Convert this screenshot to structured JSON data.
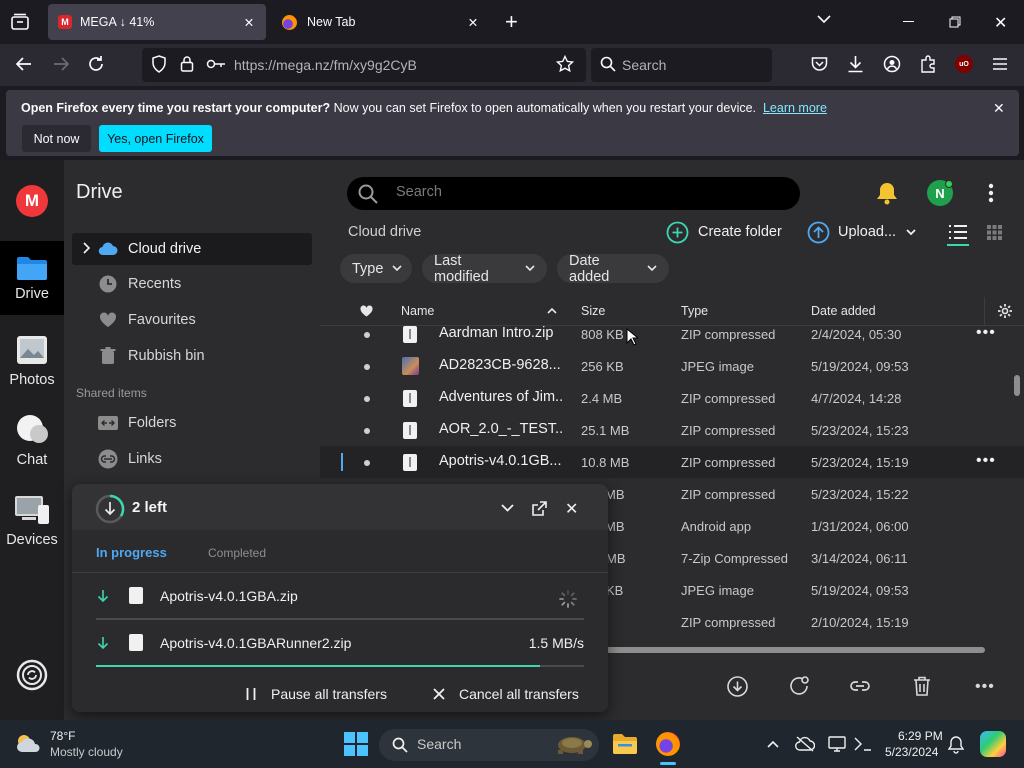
{
  "browser": {
    "tabs": [
      {
        "label": "MEGA ↓ 41%",
        "active": true
      },
      {
        "label": "New Tab",
        "active": false
      }
    ],
    "url": "https://mega.nz/fm/xy9g2CyB",
    "search_placeholder": "Search"
  },
  "notification": {
    "bold": "Open Firefox every time you restart your computer?",
    "text": " Now you can set Firefox to open automatically when you restart your device.",
    "link": "Learn more",
    "not_now": "Not now",
    "yes_button": "Yes, open Firefox"
  },
  "rail": {
    "drive": "Drive",
    "photos": "Photos",
    "chat": "Chat",
    "devices": "Devices"
  },
  "sidebar": {
    "title": "Drive",
    "items": [
      {
        "label": "Cloud drive"
      },
      {
        "label": "Recents"
      },
      {
        "label": "Favourites"
      },
      {
        "label": "Rubbish bin"
      }
    ],
    "shared_heading": "Shared items",
    "shared_items": [
      {
        "label": "Folders"
      },
      {
        "label": "Links"
      }
    ]
  },
  "main": {
    "search_placeholder": "Search",
    "avatar_letter": "N",
    "breadcrumb": "Cloud drive",
    "create_folder": "Create folder",
    "upload": "Upload...",
    "filters": {
      "type": "Type",
      "last_modified": "Last modified",
      "date_added": "Date added"
    },
    "columns": {
      "name": "Name",
      "size": "Size",
      "type": "Type",
      "date_added": "Date added"
    },
    "rows": [
      {
        "name": "Aardman Intro.zip",
        "size": "808 KB",
        "type": "ZIP compressed",
        "date": "2/4/2024, 05:30"
      },
      {
        "name": "AD2823CB-9628...",
        "size": "256 KB",
        "type": "JPEG image",
        "date": "5/19/2024, 09:53"
      },
      {
        "name": "Adventures of Jim...",
        "size": "2.4 MB",
        "type": "ZIP compressed",
        "date": "4/7/2024, 14:28"
      },
      {
        "name": "AOR_2.0_-_TEST....",
        "size": "25.1 MB",
        "type": "ZIP compressed",
        "date": "5/23/2024, 15:23"
      },
      {
        "name": "Apotris-v4.0.1GB...",
        "size": "10.8 MB",
        "type": "ZIP compressed",
        "date": "5/23/2024, 15:19"
      },
      {
        "name": "",
        "size": "MB",
        "type": "ZIP compressed",
        "date": "5/23/2024, 15:22"
      },
      {
        "name": "",
        "size": "MB",
        "type": "Android app",
        "date": "1/31/2024, 06:00"
      },
      {
        "name": "",
        "size": "MB",
        "type": "7-Zip Compressed",
        "date": "3/14/2024, 06:11"
      },
      {
        "name": "",
        "size": "KB",
        "type": "JPEG image",
        "date": "5/19/2024, 09:53"
      },
      {
        "name": "",
        "size": "",
        "type": "ZIP compressed",
        "date": "2/10/2024, 15:19"
      }
    ]
  },
  "transfers": {
    "title": "2 left",
    "tab_in_progress": "In progress",
    "tab_completed": "Completed",
    "items": [
      {
        "name": "Apotris-v4.0.1GBA.zip",
        "speed": "",
        "progress": 0
      },
      {
        "name": "Apotris-v4.0.1GBARunner2.zip",
        "speed": "1.5 MB/s",
        "progress": 0.91
      }
    ],
    "pause_all": "Pause all transfers",
    "cancel_all": "Cancel all transfers"
  },
  "taskbar": {
    "temp": "78°F",
    "weather": "Mostly cloudy",
    "search": "Search",
    "time": "6:29 PM",
    "date": "5/23/2024"
  },
  "colors": {
    "accent_cyan": "#00ddff",
    "mega_red": "#f0373a",
    "green_accent": "#3cd6b0",
    "online_green": "#1fa04d"
  }
}
